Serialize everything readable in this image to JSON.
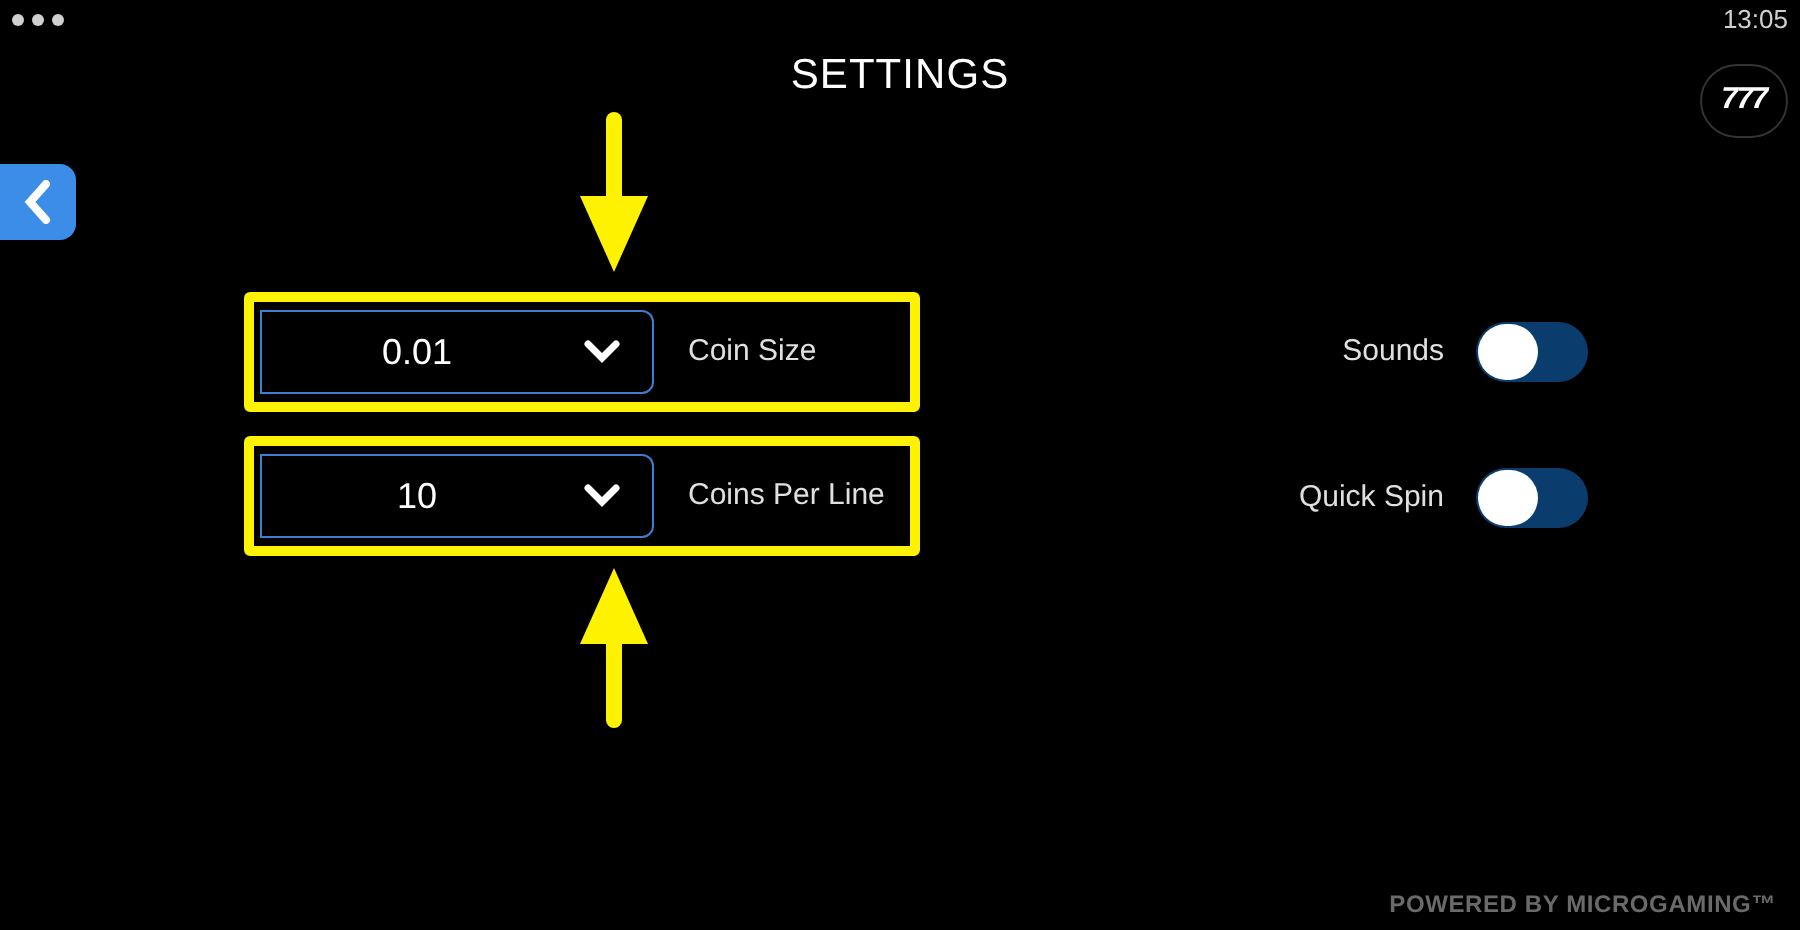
{
  "status_bar": {
    "time": "13:05"
  },
  "title": "SETTINGS",
  "logo": {
    "text": "777"
  },
  "bet_settings": [
    {
      "value": "0.01",
      "label": "Coin Size"
    },
    {
      "value": "10",
      "label": "Coins Per Line"
    }
  ],
  "toggles": [
    {
      "label": "Sounds",
      "on": false
    },
    {
      "label": "Quick Spin",
      "on": false
    }
  ],
  "footer": "POWERED BY MICROGAMING™"
}
